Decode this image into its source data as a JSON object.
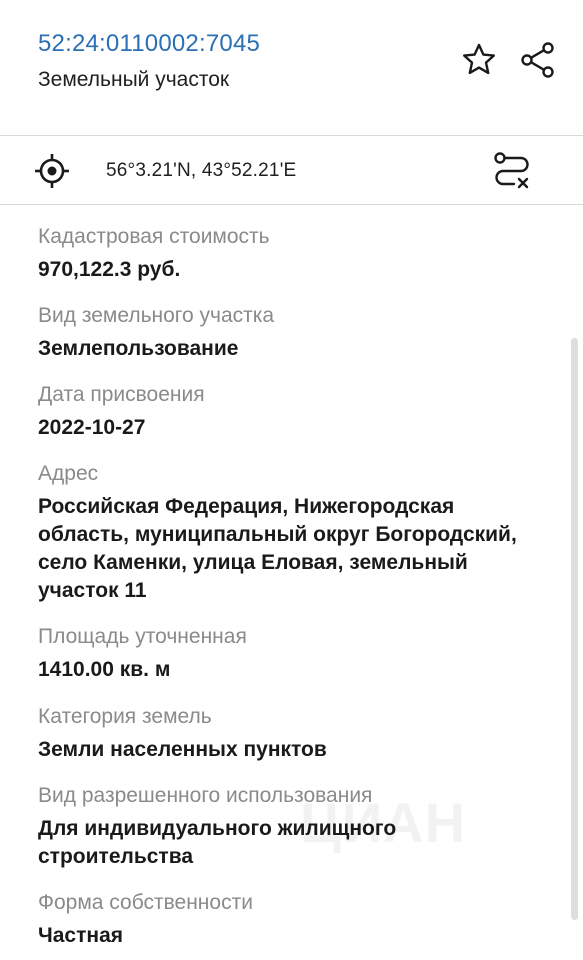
{
  "header": {
    "cadastral_number": "52:24:0110002:7045",
    "object_type": "Земельный участок",
    "favorite_icon": "star-outline-icon",
    "share_icon": "share-icon"
  },
  "location": {
    "locate_icon": "crosshair-target-icon",
    "coordinates": "56°3.21'N, 43°52.21'E",
    "route_icon": "route-cancel-icon"
  },
  "fields": [
    {
      "label": "Кадастровая стоимость",
      "value": "970,122.3 руб."
    },
    {
      "label": "Вид земельного участка",
      "value": "Землепользование"
    },
    {
      "label": "Дата присвоения",
      "value": "2022-10-27"
    },
    {
      "label": "Адрес",
      "value": "Российская Федерация, Нижегородская область, муниципальный округ Богородский, село Каменки, улица Еловая, земельный участок 11"
    },
    {
      "label": "Площадь уточненная",
      "value": "1410.00 кв. м"
    },
    {
      "label": "Категория земель",
      "value": "Земли населенных пунктов"
    },
    {
      "label": "Вид разрешенного использования",
      "value": "Для индивидуального жилищного строительства"
    },
    {
      "label": "Форма собственности",
      "value": "Частная"
    }
  ],
  "watermark": "ЦИАН",
  "colors": {
    "link": "#2b6fb4",
    "label": "#8a8a8a",
    "value": "#1a1a1a",
    "divider": "#d9d9d9"
  }
}
